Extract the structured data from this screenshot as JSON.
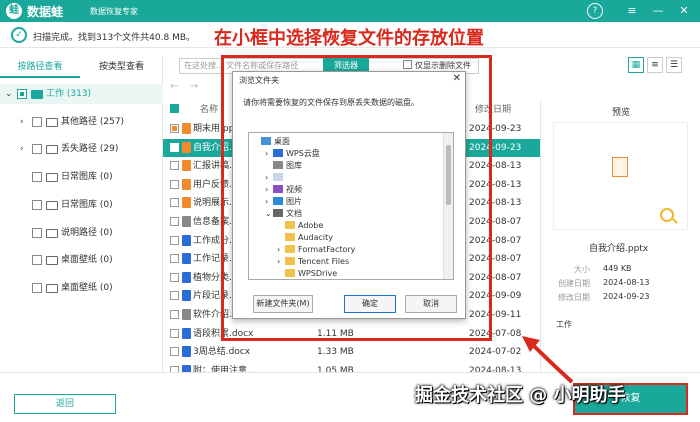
{
  "titlebar": {
    "logo_glyph": "蛙",
    "app_name": "数据蛙",
    "app_subtitle": "数据恢复专家",
    "help": "?",
    "menu": "≡",
    "minimize": "—",
    "close": "✕"
  },
  "scan": {
    "check": "✓",
    "status": "扫描完成。找到313个文件共40.8 MB。"
  },
  "annotation": {
    "top": "在小框中选择恢复文件的存放位置"
  },
  "left": {
    "tab_path": "按路径查看",
    "tab_type": "按类型查看",
    "items": [
      {
        "label": "工作 (313)"
      },
      {
        "label": "其他路径 (257)"
      },
      {
        "label": "丢失路径 (29)"
      },
      {
        "label": "日常图库 (0)"
      },
      {
        "label": "日常图库 (0)"
      },
      {
        "label": "说明路径 (0)"
      },
      {
        "label": "桌面壁纸 (0)"
      },
      {
        "label": "桌面壁纸 (0)"
      }
    ]
  },
  "toolbar": {
    "search_placeholder": "在这处搜... 文件名称或保存路径",
    "filter": "筛选器",
    "only_deleted": "仅显示删除文件",
    "view_icons": [
      "▦",
      "≡",
      "☰"
    ]
  },
  "table": {
    "col_name": "名称",
    "col_date": "修改日期",
    "rows": [
      {
        "name": "期末用.pptx",
        "size": "",
        "date": "2024-09-23",
        "color": "#f18b2e"
      },
      {
        "name": "自我介绍.pptx",
        "size": "",
        "date": "2024-09-23",
        "color": "#f18b2e"
      },
      {
        "name": "汇报讲稿.pptx",
        "size": "",
        "date": "2024-08-13",
        "color": "#f18b2e"
      },
      {
        "name": "用户反馈.pptx",
        "size": "",
        "date": "2024-08-13",
        "color": "#f18b2e"
      },
      {
        "name": "说明展示.pptx",
        "size": "",
        "date": "2024-08-13",
        "color": "#f18b2e"
      },
      {
        "name": "信息备案.txt",
        "size": "",
        "date": "2024-08-07",
        "color": "#888888"
      },
      {
        "name": "工作成分.docx",
        "size": "",
        "date": "2024-08-07",
        "color": "#2b6cd9"
      },
      {
        "name": "工作记录.docx",
        "size": "",
        "date": "2024-08-07",
        "color": "#2b6cd9"
      },
      {
        "name": "植物分类.docx",
        "size": "",
        "date": "2024-08-07",
        "color": "#2b6cd9"
      },
      {
        "name": "片段记录.docx",
        "size": "",
        "date": "2024-09-09",
        "color": "#2b6cd9"
      },
      {
        "name": "软件介绍.txt",
        "size": "",
        "date": "2024-09-11",
        "color": "#888888"
      },
      {
        "name": "语段积累.docx",
        "size": "1.11 MB",
        "date": "2024-07-08",
        "color": "#2b6cd9"
      },
      {
        "name": "3周总结.docx",
        "size": "1.33 MB",
        "date": "2024-07-02",
        "color": "#2b6cd9"
      },
      {
        "name": "附：使用注意...",
        "size": "1.05 MB",
        "date": "2024-08-13",
        "color": "#2b6cd9"
      }
    ]
  },
  "preview": {
    "title": "预览",
    "file_name": "自我介绍.pptx",
    "size_label": "大小",
    "size_value": "449 KB",
    "created_label": "创建日期",
    "created_value": "2024-08-13",
    "modified_label": "修改日期",
    "modified_value": "2024-09-23",
    "path_label": "工作"
  },
  "bottom": {
    "back": "返回",
    "recover": "恢复"
  },
  "watermark": "掘金技术社区 @ 小明助手",
  "dialog": {
    "title": "浏览文件夹",
    "close": "✕",
    "message": "请你将需要恢复的文件保存到原丢失数据的磁盘。",
    "tree": [
      {
        "label": "桌面",
        "indent": 0,
        "icon": "#4a90d9",
        "arrow": ""
      },
      {
        "label": "WPS云盘",
        "indent": 1,
        "icon": "#2b6cd9",
        "arrow": "›"
      },
      {
        "label": "图库",
        "indent": 1,
        "icon": "#888888",
        "arrow": ""
      },
      {
        "label": "",
        "indent": 1,
        "icon": "#c9d6e8",
        "arrow": "›"
      },
      {
        "label": "视频",
        "indent": 1,
        "icon": "#8a4fc4",
        "arrow": "›"
      },
      {
        "label": "图片",
        "indent": 1,
        "icon": "#2b8ad9",
        "arrow": "›"
      },
      {
        "label": "文档",
        "indent": 1,
        "icon": "#666666",
        "arrow": "⌄"
      },
      {
        "label": "Adobe",
        "indent": 2,
        "icon": "#f0c24b",
        "arrow": ""
      },
      {
        "label": "Audacity",
        "indent": 2,
        "icon": "#f0c24b",
        "arrow": ""
      },
      {
        "label": "FormatFactory",
        "indent": 2,
        "icon": "#f0c24b",
        "arrow": "›"
      },
      {
        "label": "Tencent Files",
        "indent": 2,
        "icon": "#f0c24b",
        "arrow": "›"
      },
      {
        "label": "WPSDrive",
        "indent": 2,
        "icon": "#f0c24b",
        "arrow": ""
      }
    ],
    "new_folder": "新建文件夹(M)",
    "ok": "确定",
    "cancel": "取消"
  }
}
